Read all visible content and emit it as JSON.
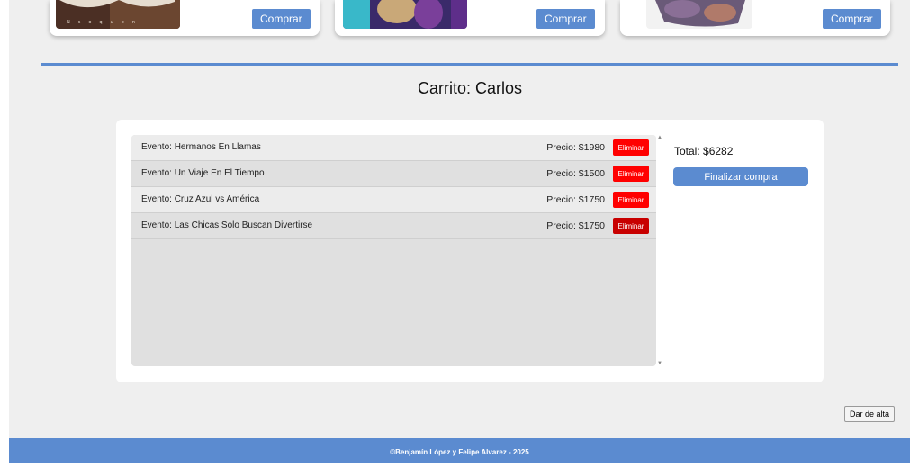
{
  "cards": [
    {
      "buy_label": "Comprar",
      "image_text": "Nsoquen"
    },
    {
      "buy_label": "Comprar"
    },
    {
      "buy_label": "Comprar"
    }
  ],
  "cart": {
    "title": "Carrito: Carlos",
    "items": [
      {
        "event": "Evento: Hermanos En Llamas",
        "price": "Precio: $1980",
        "remove_label": "Eliminar"
      },
      {
        "event": "Evento: Un Viaje En El Tiempo",
        "price": "Precio: $1500",
        "remove_label": "Eliminar"
      },
      {
        "event": "Evento: Cruz Azul vs América",
        "price": "Precio: $1750",
        "remove_label": "Eliminar"
      },
      {
        "event": "Evento: Las Chicas Solo Buscan Divertirse",
        "price": "Precio: $1750",
        "remove_label": "Eliminar"
      }
    ],
    "total": "Total: $6282",
    "finalize_label": "Finalizar compra"
  },
  "alta_label": "Dar de alta",
  "footer_text": "©Benjamín López y Felipe Alvarez - 2025",
  "colors": {
    "accent": "#5b8bd0",
    "danger": "#ff0000",
    "background": "#efefef"
  }
}
